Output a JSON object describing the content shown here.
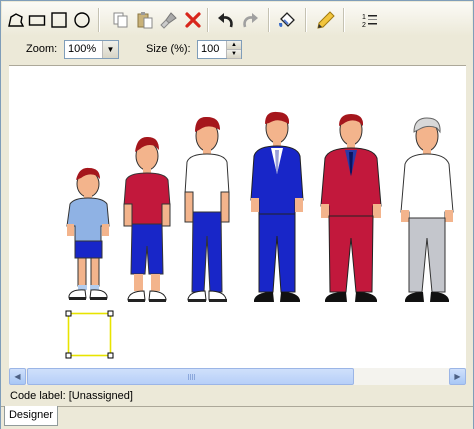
{
  "toolbar": {
    "tools": [
      {
        "name": "freeform-shape-tool-icon"
      },
      {
        "name": "rectangle-tool-icon"
      },
      {
        "name": "square-tool-icon"
      },
      {
        "name": "ellipse-tool-icon"
      },
      {
        "name": "copy-icon"
      },
      {
        "name": "paste-icon"
      },
      {
        "name": "clear-brush-icon"
      },
      {
        "name": "delete-icon"
      },
      {
        "name": "undo-icon"
      },
      {
        "name": "redo-icon"
      },
      {
        "name": "fill-bucket-icon"
      },
      {
        "name": "pencil-icon"
      },
      {
        "name": "list-order-icon"
      }
    ]
  },
  "options": {
    "zoom_label": "Zoom:",
    "zoom_value": "100%",
    "size_label": "Size (%):",
    "size_value": "100"
  },
  "status": {
    "code_label": "Code label: [Unassigned]"
  },
  "tabs": {
    "designer": "Designer"
  },
  "colors": {
    "selection": "#e8e400",
    "border": "#7f9db9"
  }
}
